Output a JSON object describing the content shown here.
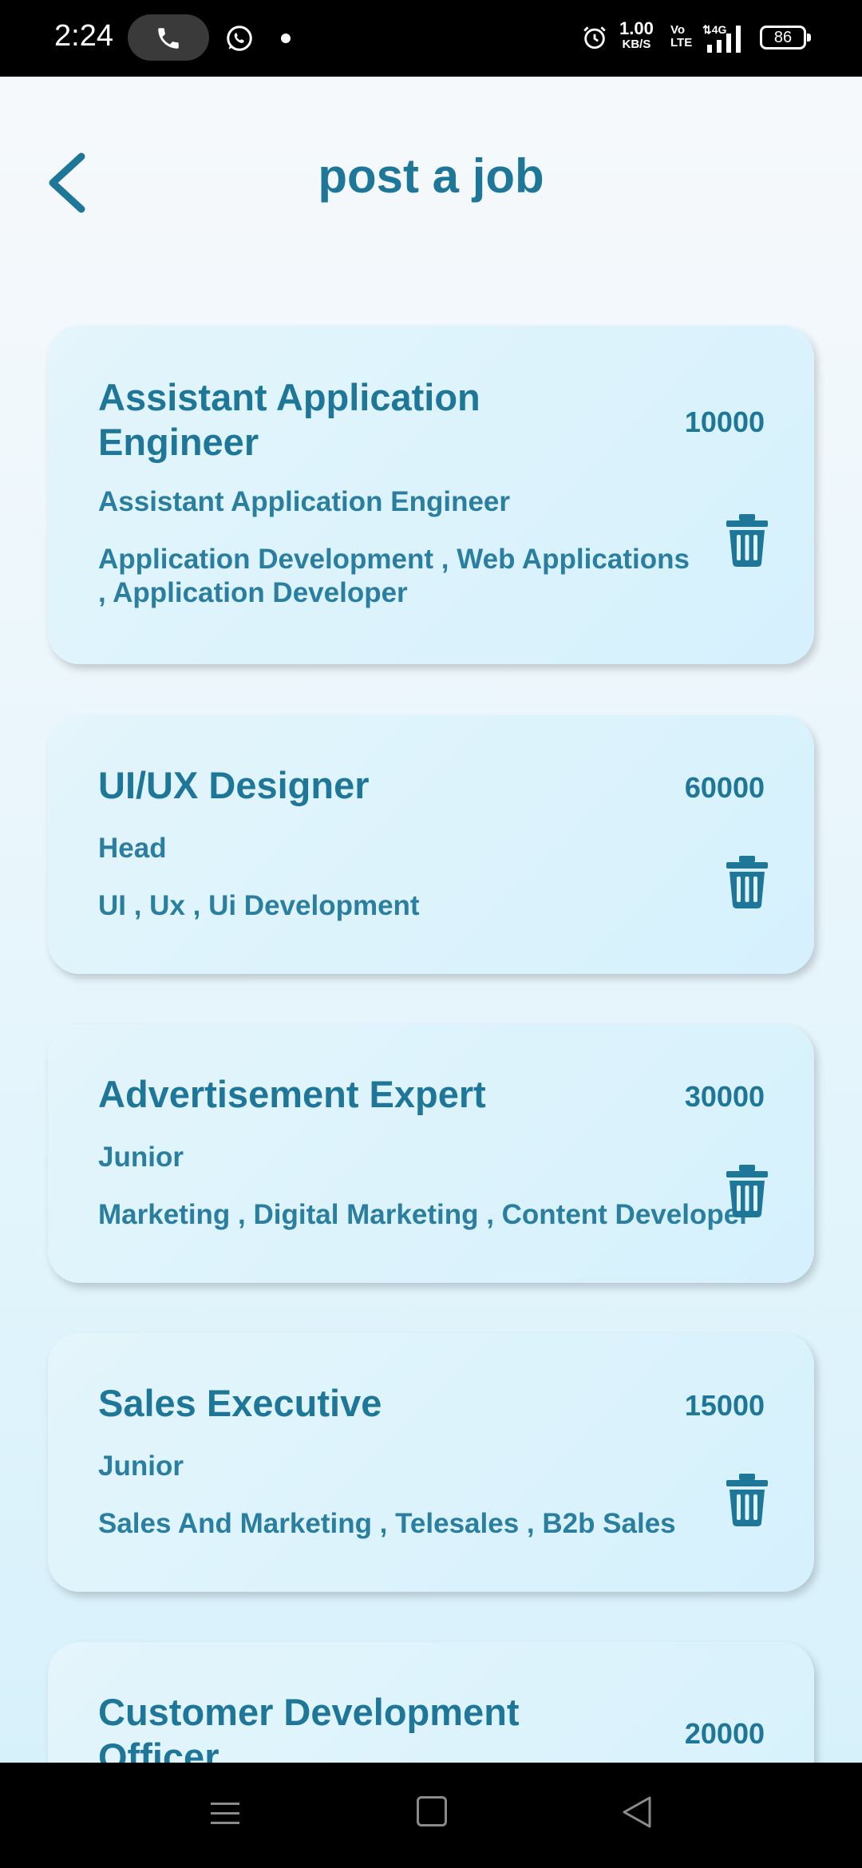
{
  "status_bar": {
    "time": "2:24",
    "net_speed_value": "1.00",
    "net_speed_unit": "KB/S",
    "volte_top": "Vo",
    "volte_bottom": "LTE",
    "network": "4G",
    "battery": "86"
  },
  "header": {
    "title": "post a job"
  },
  "jobs": [
    {
      "title": "Assistant Application Engineer",
      "salary": "10000",
      "level": "Assistant Application Engineer",
      "skills": "Application Development , Web Applications , Application Developer"
    },
    {
      "title": "UI/UX Designer",
      "salary": "60000",
      "level": "Head",
      "skills": "UI , Ux , Ui Development"
    },
    {
      "title": "Advertisement Expert",
      "salary": "30000",
      "level": "Junior",
      "skills": "Marketing , Digital Marketing , Content Developer"
    },
    {
      "title": "Sales Executive",
      "salary": "15000",
      "level": "Junior",
      "skills": "Sales And Marketing , Telesales , B2b Sales"
    },
    {
      "title": "Customer Development Officer",
      "salary": "20000"
    }
  ],
  "colors": {
    "accent": "#1e7698",
    "card_bg": "#dff4fc"
  }
}
